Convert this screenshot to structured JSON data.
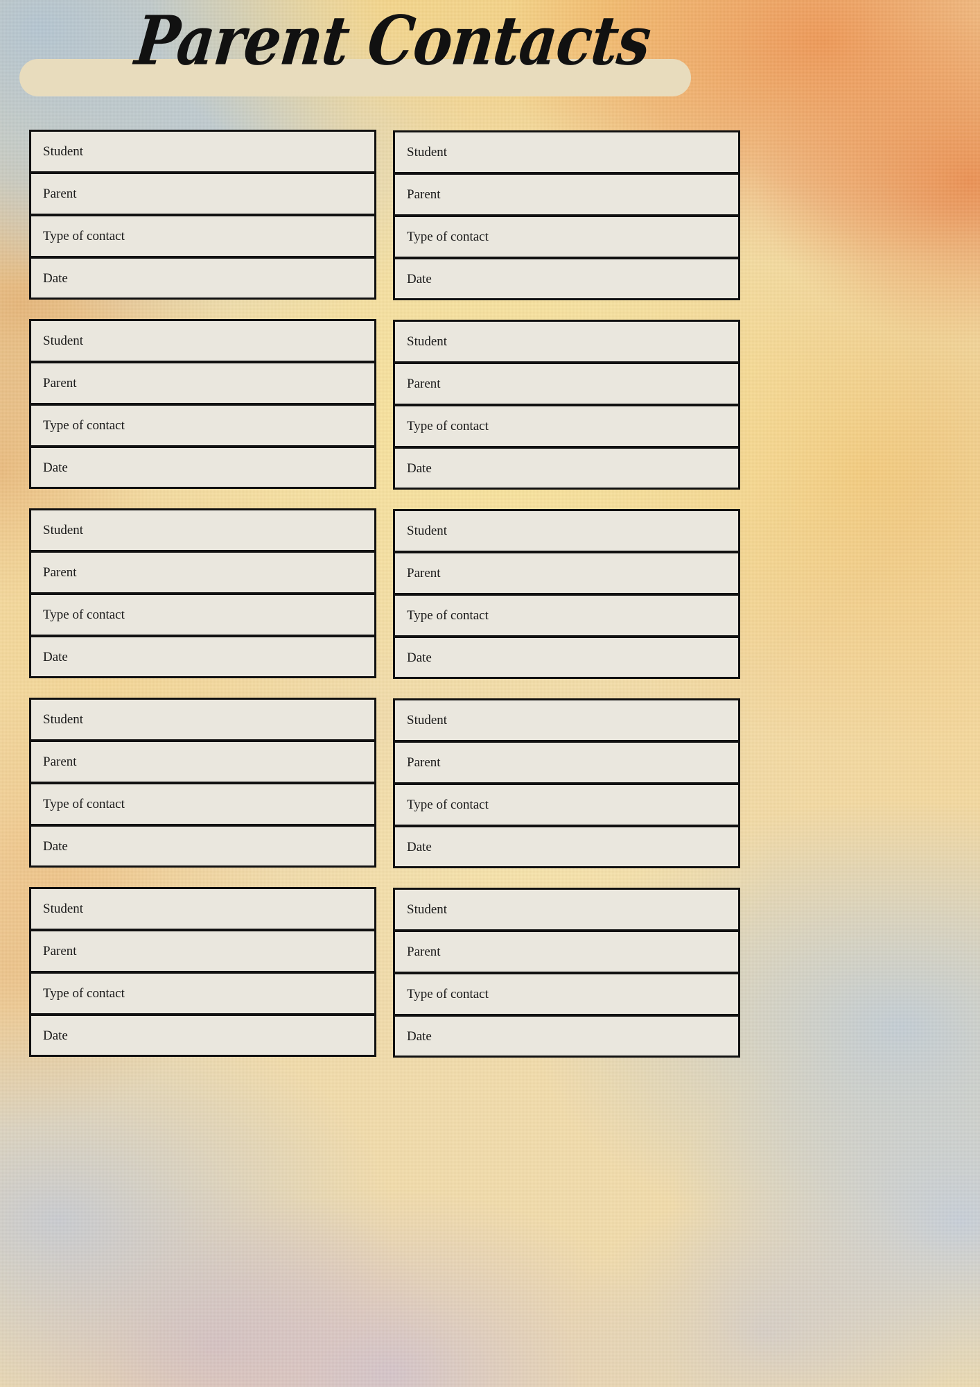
{
  "page": {
    "title": "Parent Contacts",
    "background_colors": {
      "paper_top_left": "#b0c4d4",
      "paper_orange": "#ee9654",
      "paper_yellow": "#fae498",
      "paper_bottom_blue": "#c4cede"
    }
  },
  "banner": {
    "fill_color": "#e8dcbd"
  },
  "card_style": {
    "cell_fill": "#eae7de",
    "border_color": "#111111"
  },
  "fields": {
    "student": "Student",
    "parent": "Parent",
    "type_of_contact": "Type of contact",
    "date": "Date"
  },
  "cards": [
    {
      "index": 1,
      "rows": [
        {
          "label": "Student",
          "value": ""
        },
        {
          "label": "Parent",
          "value": ""
        },
        {
          "label": "Type of contact",
          "value": ""
        },
        {
          "label": "Date",
          "value": ""
        }
      ]
    },
    {
      "index": 2,
      "rows": [
        {
          "label": "Student",
          "value": ""
        },
        {
          "label": "Parent",
          "value": ""
        },
        {
          "label": "Type of contact",
          "value": ""
        },
        {
          "label": "Date",
          "value": ""
        }
      ]
    },
    {
      "index": 3,
      "rows": [
        {
          "label": "Student",
          "value": ""
        },
        {
          "label": "Parent",
          "value": ""
        },
        {
          "label": "Type of contact",
          "value": ""
        },
        {
          "label": "Date",
          "value": ""
        }
      ]
    },
    {
      "index": 4,
      "rows": [
        {
          "label": "Student",
          "value": ""
        },
        {
          "label": "Parent",
          "value": ""
        },
        {
          "label": "Type of contact",
          "value": ""
        },
        {
          "label": "Date",
          "value": ""
        }
      ]
    },
    {
      "index": 5,
      "rows": [
        {
          "label": "Student",
          "value": ""
        },
        {
          "label": "Parent",
          "value": ""
        },
        {
          "label": "Type of contact",
          "value": ""
        },
        {
          "label": "Date",
          "value": ""
        }
      ]
    },
    {
      "index": 6,
      "rows": [
        {
          "label": "Student",
          "value": ""
        },
        {
          "label": "Parent",
          "value": ""
        },
        {
          "label": "Type of contact",
          "value": ""
        },
        {
          "label": "Date",
          "value": ""
        }
      ]
    },
    {
      "index": 7,
      "rows": [
        {
          "label": "Student",
          "value": ""
        },
        {
          "label": "Parent",
          "value": ""
        },
        {
          "label": "Type of contact",
          "value": ""
        },
        {
          "label": "Date",
          "value": ""
        }
      ]
    },
    {
      "index": 8,
      "rows": [
        {
          "label": "Student",
          "value": ""
        },
        {
          "label": "Parent",
          "value": ""
        },
        {
          "label": "Type of contact",
          "value": ""
        },
        {
          "label": "Date",
          "value": ""
        }
      ]
    },
    {
      "index": 9,
      "rows": [
        {
          "label": "Student",
          "value": ""
        },
        {
          "label": "Parent",
          "value": ""
        },
        {
          "label": "Type of contact",
          "value": ""
        },
        {
          "label": "Date",
          "value": ""
        }
      ]
    },
    {
      "index": 10,
      "rows": [
        {
          "label": "Student",
          "value": ""
        },
        {
          "label": "Parent",
          "value": ""
        },
        {
          "label": "Type of contact",
          "value": ""
        },
        {
          "label": "Date",
          "value": ""
        }
      ]
    }
  ]
}
